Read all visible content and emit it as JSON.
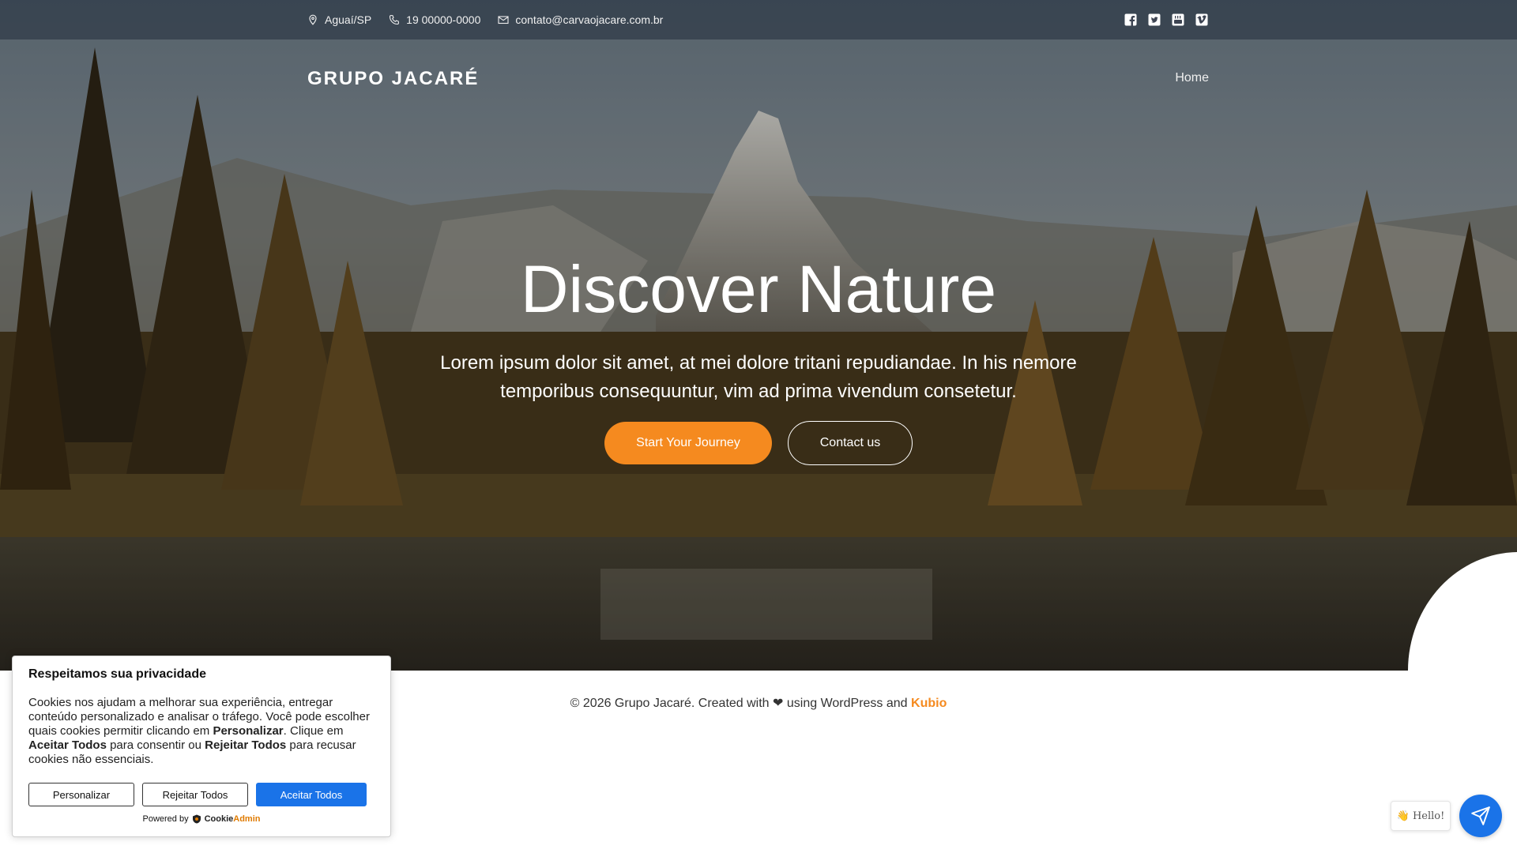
{
  "topbar": {
    "location": "Aguaí/SP",
    "phone": "19 00000-0000",
    "email": "contato@carvaojacare.com.br",
    "social_icons": [
      "facebook-icon",
      "twitter-icon",
      "youtube-icon",
      "vimeo-icon"
    ]
  },
  "nav": {
    "brand": "GRUPO JACARÉ",
    "home": "Home"
  },
  "hero": {
    "title": "Discover Nature",
    "text": "Lorem ipsum dolor sit amet, at mei dolore tritani repudiandae. In his nemore temporibus consequuntur, vim ad prima vivendum consetetur.",
    "primary_button": "Start Your Journey",
    "secondary_button": "Contact us"
  },
  "footer": {
    "prefix": "© 2026 Grupo Jacaré. Created with",
    "heart": "❤",
    "middle": "using WordPress and",
    "link": "Kubio"
  },
  "cookie": {
    "title": "Respeitamos sua privacidade",
    "text_1": "Cookies nos ajudam a melhorar sua experiência, entregar conteúdo personalizado e analisar o tráfego. Você pode escolher quais cookies permitir clicando em ",
    "bold_1": "Personalizar",
    "text_2": ". Clique em ",
    "bold_2": "Aceitar Todos",
    "text_3": " para consentir ou ",
    "bold_3": "Rejeitar Todos",
    "text_4": " para recusar cookies não essenciais.",
    "btn_customize": "Personalizar",
    "btn_reject": "Rejeitar Todos",
    "btn_accept": "Aceitar Todos",
    "powered_by": "Powered by",
    "brand_a": "Cookie",
    "brand_b": "Admin"
  },
  "chat": {
    "greeting": "👋 Hello!"
  },
  "colors": {
    "accent": "#f58a1f",
    "primary_blue": "#1a73e8"
  }
}
